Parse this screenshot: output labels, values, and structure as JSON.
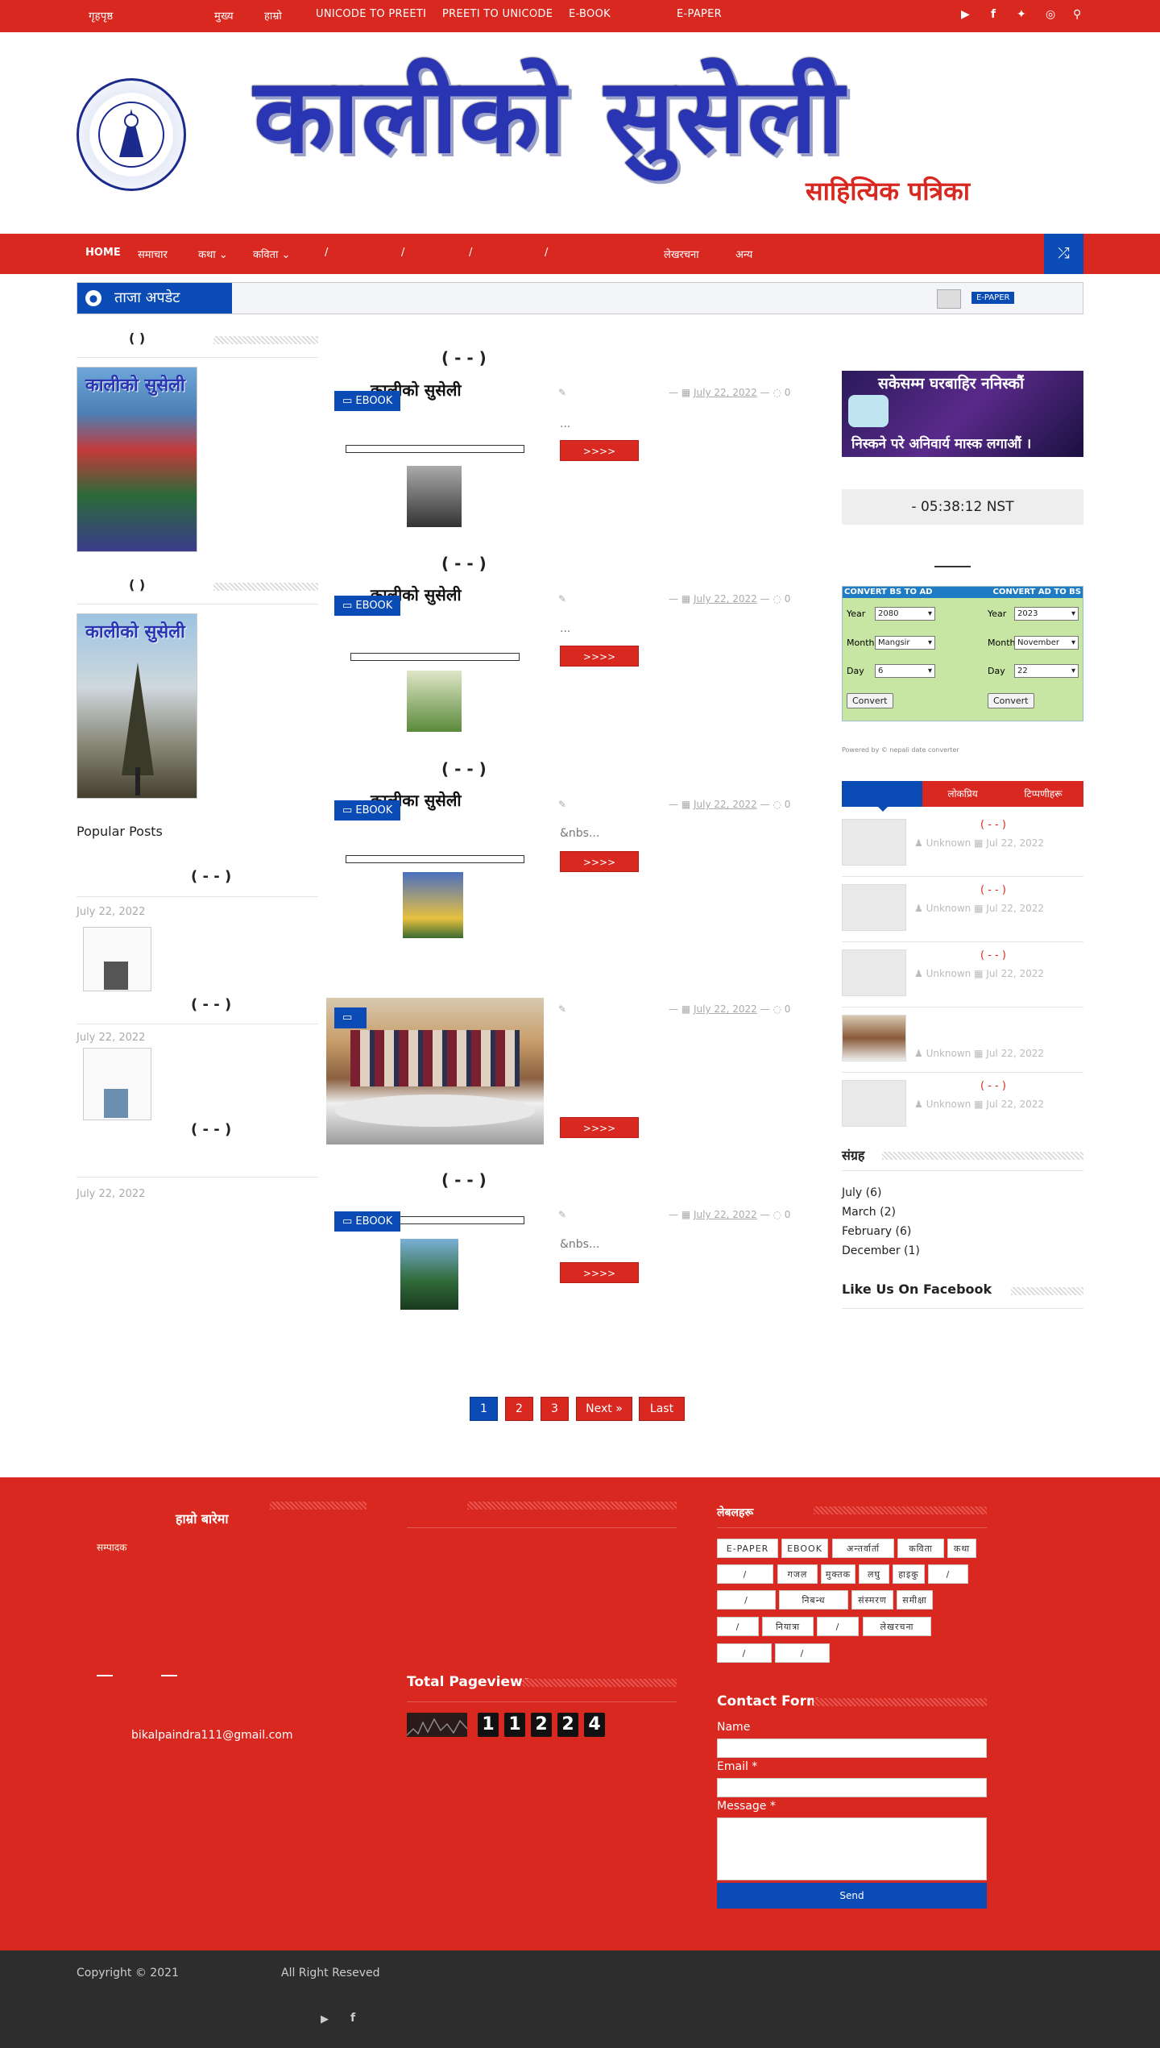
{
  "topbar": {
    "nav": [
      "मुख्य",
      "हाम्रो",
      "UNICODE TO PREETI",
      "PREETI TO UNICODE",
      "E-BOOK",
      "E-PAPER"
    ],
    "home_label": "गृहपृष्ठ"
  },
  "header": {
    "title": "कालीको सुसेली",
    "subtitle": "साहित्यिक पत्रिका"
  },
  "menu": {
    "home": "HOME",
    "items": [
      "समाचार",
      "कथा",
      "कविता",
      "/",
      "/",
      "/",
      "/",
      "लेखरचना",
      "अन्य"
    ]
  },
  "ticker": {
    "label": "ताजा अपडेट",
    "badge": "E-PAPER"
  },
  "left": {
    "widget1_title": "(          )",
    "widget2_title": "(          )",
    "popular_title": "Popular Posts",
    "popular": [
      {
        "title": "(     -   -   )",
        "date": "July 22, 2022"
      },
      {
        "title": "(     -   -   )",
        "date": "July 22, 2022"
      },
      {
        "title": "(     -   -   )",
        "date": "July 22, 2022"
      }
    ]
  },
  "posts": [
    {
      "title": "(     -   -   )",
      "badge": "EBOOK",
      "date": "July 22, 2022",
      "comments": "0",
      "excerpt": "...",
      "more": ">>>>",
      "img_title": "कालीको सुसेली"
    },
    {
      "title": "(     -   -   )",
      "badge": "EBOOK",
      "date": "July 22, 2022",
      "comments": "0",
      "excerpt": "...",
      "more": ">>>>",
      "img_title": "कालीको सुसेली"
    },
    {
      "title": "(     -   -   )",
      "badge": "EBOOK",
      "date": "July 22, 2022",
      "comments": "0",
      "excerpt": "&nbs...",
      "more": ">>>>",
      "img_title": "कालीका सुसेली"
    },
    {
      "title": "",
      "badge": "",
      "date": "July 22, 2022",
      "comments": "0",
      "excerpt": "",
      "more": ">>>>",
      "img_title": ""
    },
    {
      "title": "(     -   -   )",
      "badge": "EBOOK",
      "date": "July 22, 2022",
      "comments": "0",
      "excerpt": "&nbs...",
      "more": ">>>>",
      "img_title": ""
    }
  ],
  "pagination": [
    "1",
    "2",
    "3",
    "Next »",
    "Last"
  ],
  "right": {
    "ad_text_top": "सकेसम्म घरबाहिर ननिस्कौं",
    "ad_text_bottom": "निस्कने परे अनिवार्य मास्क लगाऔं ।",
    "clock": "- 05:38:12 NST",
    "converter": {
      "left_head": "CONVERT BS TO AD",
      "right_head": "CONVERT AD TO BS",
      "year_label": "Year",
      "month_label": "Month",
      "day_label": "Day",
      "bs_year": "2080",
      "bs_month": "Mangsir",
      "bs_day": "6",
      "ad_year": "2023",
      "ad_month": "November",
      "ad_day": "22",
      "button": "Convert",
      "powered": "Powered by © nepali date converter"
    },
    "tabs": [
      "",
      "लोकप्रिय",
      "टिप्पणीहरू"
    ],
    "recent": [
      {
        "title": "(     -   -   )",
        "author": "Unknown",
        "date": "Jul 22, 2022"
      },
      {
        "title": "(     -   -   )",
        "author": "Unknown",
        "date": "Jul 22, 2022"
      },
      {
        "title": "(     -   -   )",
        "author": "Unknown",
        "date": "Jul 22, 2022"
      },
      {
        "title": "",
        "author": "Unknown",
        "date": "Jul 22, 2022"
      },
      {
        "title": "(     -   -   )",
        "author": "Unknown",
        "date": "Jul 22, 2022"
      }
    ],
    "archive_title": "संग्रह",
    "archive": [
      "July (6)",
      "March (2)",
      "February (6)",
      "December (1)"
    ],
    "facebook_title": "Like Us On Facebook"
  },
  "footer": {
    "about_title": "हाम्रो बारेमा",
    "about_sub": "सम्पादक",
    "email": "bikalpaindra111@gmail.com",
    "pageviews_title": "Total Pageviews",
    "pageviews": [
      "1",
      "1",
      "2",
      "2",
      "4"
    ],
    "labels_title": "लेबलहरू",
    "tags": [
      "E-PAPER",
      "EBOOK",
      "अन्तर्वार्ता",
      "कविता",
      "कथा",
      "/",
      "गजल",
      "मुक्तक",
      "लघु",
      "हाइकु",
      "/",
      "/",
      "निबन्ध",
      "संस्मरण",
      "समीक्षा",
      "/",
      "नियात्रा",
      "/",
      "लेखरचना",
      "/"
    ],
    "contact_title": "Contact Form",
    "name_label": "Name",
    "email_label": "Email",
    "message_label": "Message",
    "required": "*",
    "send": "Send"
  },
  "bottom": {
    "copyright": "Copyright © 2021",
    "rights": "All Right Reseved"
  }
}
